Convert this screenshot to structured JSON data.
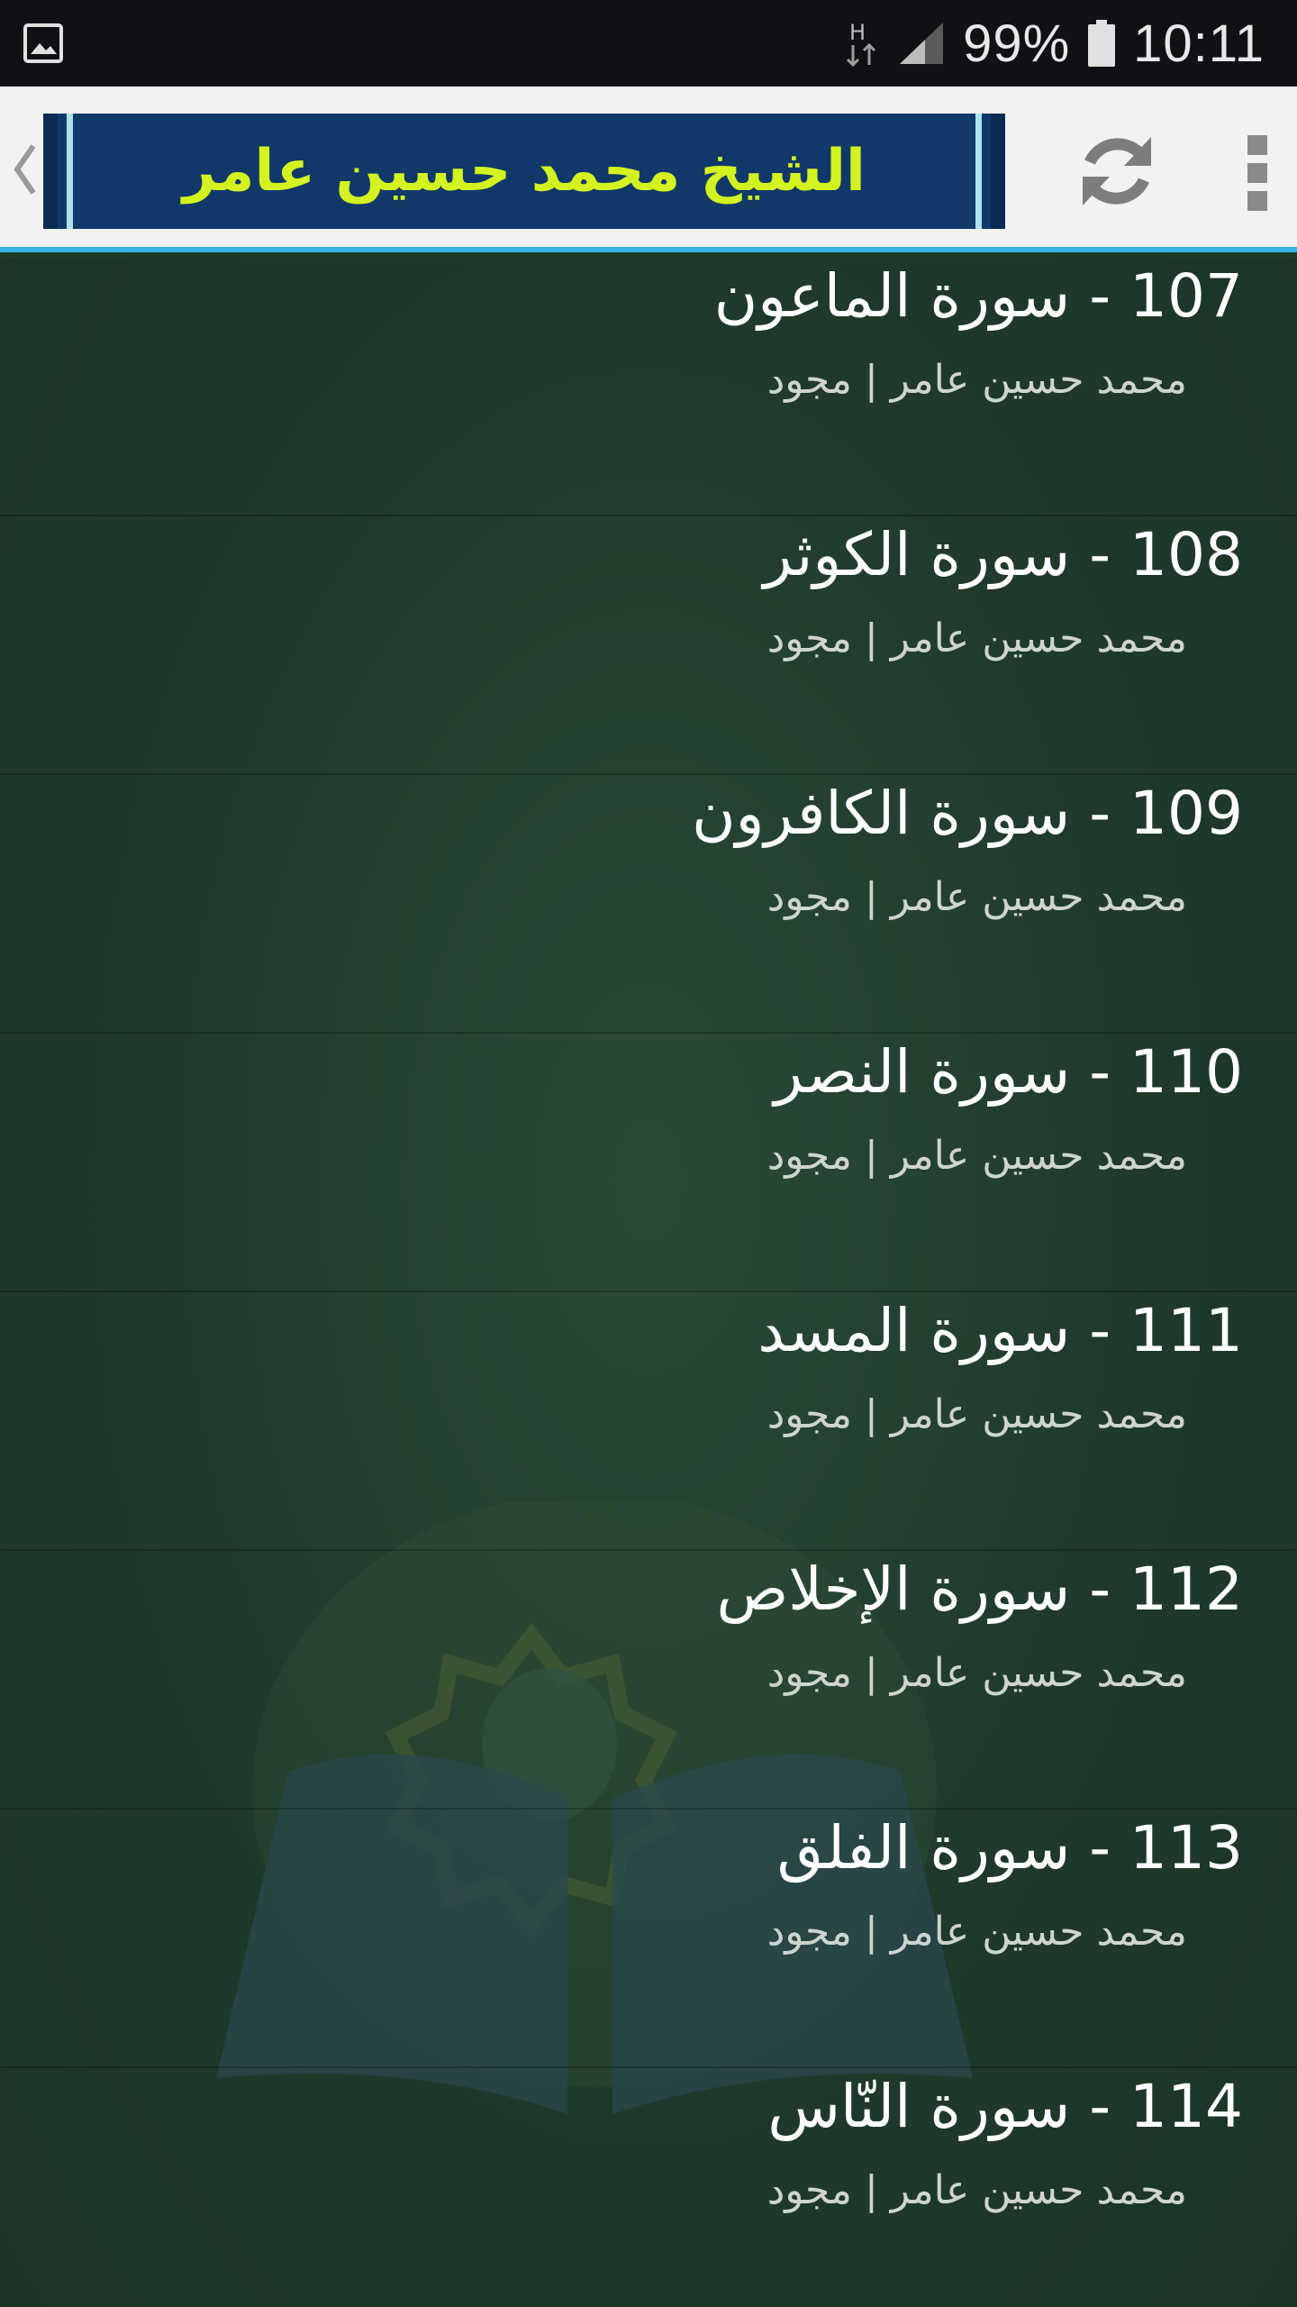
{
  "status_bar": {
    "battery": "99%",
    "time": "10:11",
    "icons": [
      "gallery-icon",
      "network-icon",
      "signal-icon",
      "battery-icon"
    ]
  },
  "app_bar": {
    "banner_text": "الشيخ محمد حسين عامر",
    "icons": [
      "back-chevron-icon",
      "refresh-icon",
      "overflow-menu-icon"
    ],
    "accent_color": "#33b5e5",
    "banner_text_color": "#d4f21f",
    "banner_bg_color": "#10396a"
  },
  "list": {
    "items": [
      {
        "title": "107 - سورة الماعون",
        "subtitle": "محمد حسين عامر | مجود"
      },
      {
        "title": "108 - سورة الكوثر",
        "subtitle": "محمد حسين عامر | مجود"
      },
      {
        "title": "109 - سورة الكافرون",
        "subtitle": "محمد حسين عامر | مجود"
      },
      {
        "title": "110 - سورة النصر",
        "subtitle": "محمد حسين عامر | مجود"
      },
      {
        "title": "111 - سورة المسد",
        "subtitle": "محمد حسين عامر | مجود"
      },
      {
        "title": "112 - سورة الإخلاص",
        "subtitle": "محمد حسين عامر | مجود"
      },
      {
        "title": "113 - سورة الفلق",
        "subtitle": "محمد حسين عامر | مجود"
      },
      {
        "title": "114 - سورة النّاس",
        "subtitle": "محمد حسين عامر | مجود"
      }
    ]
  },
  "background": {
    "color": "#1e3a2c",
    "watermark": "open-book-icon"
  }
}
